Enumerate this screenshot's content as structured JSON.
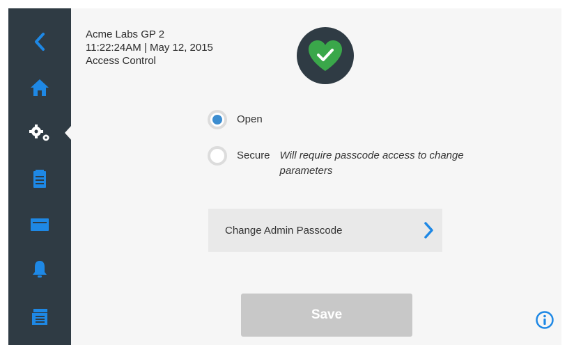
{
  "colors": {
    "sidebar": "#2f3b44",
    "accent": "#1e88e5",
    "status_green": "#3aa74a",
    "radio_selected": "#3c8dd0",
    "save_disabled": "#c8c8c8"
  },
  "sidebar": {
    "items": [
      {
        "icon": "back-chevron-icon"
      },
      {
        "icon": "home-icon"
      },
      {
        "icon": "settings-gears-icon",
        "active": true
      },
      {
        "icon": "clipboard-icon"
      },
      {
        "icon": "storage-card-icon"
      },
      {
        "icon": "bell-icon"
      },
      {
        "icon": "list-tray-icon"
      }
    ]
  },
  "header": {
    "device_name": "Acme Labs GP 2",
    "datetime": "11:22:24AM | May 12, 2015",
    "page_title": "Access Control",
    "status_icon": "heart-check-icon"
  },
  "access_mode": {
    "selected": "open",
    "options": [
      {
        "value": "open",
        "label": "Open",
        "hint": ""
      },
      {
        "value": "secure",
        "label": "Secure",
        "hint": "Will require passcode access to change parameters"
      }
    ]
  },
  "change_passcode": {
    "label": "Change Admin Passcode",
    "icon": "chevron-right-icon"
  },
  "save": {
    "label": "Save",
    "enabled": false
  },
  "info": {
    "icon": "info-icon"
  }
}
